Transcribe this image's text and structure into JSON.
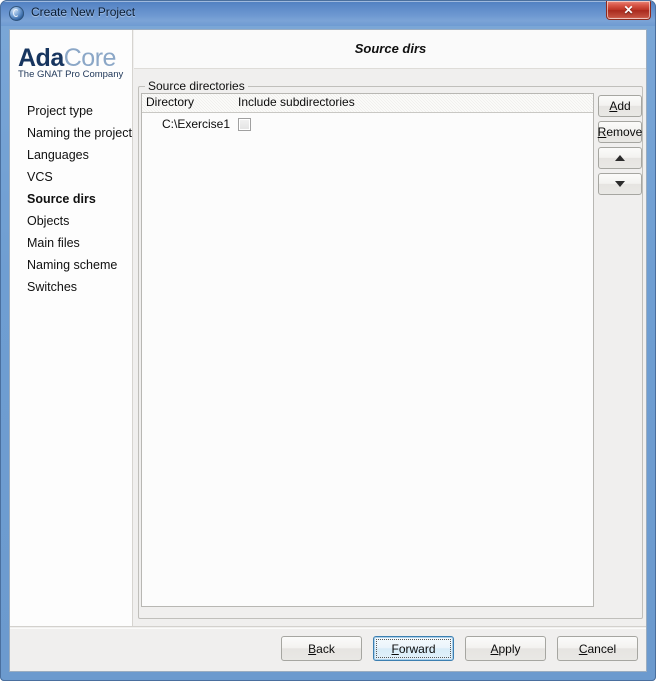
{
  "window": {
    "title": "Create New Project",
    "icon": "gps-app-icon",
    "close_label": "✕",
    "frame_color": "#6c9ace",
    "titlebar_color": "#5886c6",
    "close_color": "#bc3324"
  },
  "sidebar": {
    "logo": {
      "word_primary": "Ada",
      "word_secondary": "Core",
      "tagline": "The GNAT Pro Company",
      "primary_color": "#17355f",
      "secondary_color": "#8ba7c7"
    },
    "items": [
      {
        "label": "Project type",
        "selected": false
      },
      {
        "label": "Naming the project",
        "selected": false
      },
      {
        "label": "Languages",
        "selected": false
      },
      {
        "label": "VCS",
        "selected": false
      },
      {
        "label": "Source dirs",
        "selected": true
      },
      {
        "label": "Objects",
        "selected": false
      },
      {
        "label": "Main files",
        "selected": false
      },
      {
        "label": "Naming scheme",
        "selected": false
      },
      {
        "label": "Switches",
        "selected": false
      }
    ]
  },
  "main": {
    "page_title": "Source dirs",
    "groupbox": {
      "legend": "Source directories",
      "columns": [
        {
          "key": "directory",
          "label": "Directory"
        },
        {
          "key": "include_subdirectories",
          "label": "Include subdirectories"
        }
      ],
      "rows": [
        {
          "directory": "C:\\Exercise1",
          "include_subdirectories": false
        }
      ]
    },
    "side_buttons": [
      {
        "name": "add",
        "label": "Add",
        "mnemonic": "A"
      },
      {
        "name": "remove",
        "label": "Remove",
        "mnemonic": "R"
      },
      {
        "name": "move-up",
        "label": "",
        "glyph": "arrow-up"
      },
      {
        "name": "move-down",
        "label": "",
        "glyph": "arrow-down"
      }
    ]
  },
  "footer": {
    "buttons": [
      {
        "name": "back",
        "label": "Back",
        "mnemonic": "B",
        "focused": false
      },
      {
        "name": "forward",
        "label": "Forward",
        "mnemonic": "F",
        "focused": true
      },
      {
        "name": "apply",
        "label": "Apply",
        "mnemonic": "A",
        "focused": false
      },
      {
        "name": "cancel",
        "label": "Cancel",
        "mnemonic": "C",
        "focused": false
      }
    ]
  }
}
